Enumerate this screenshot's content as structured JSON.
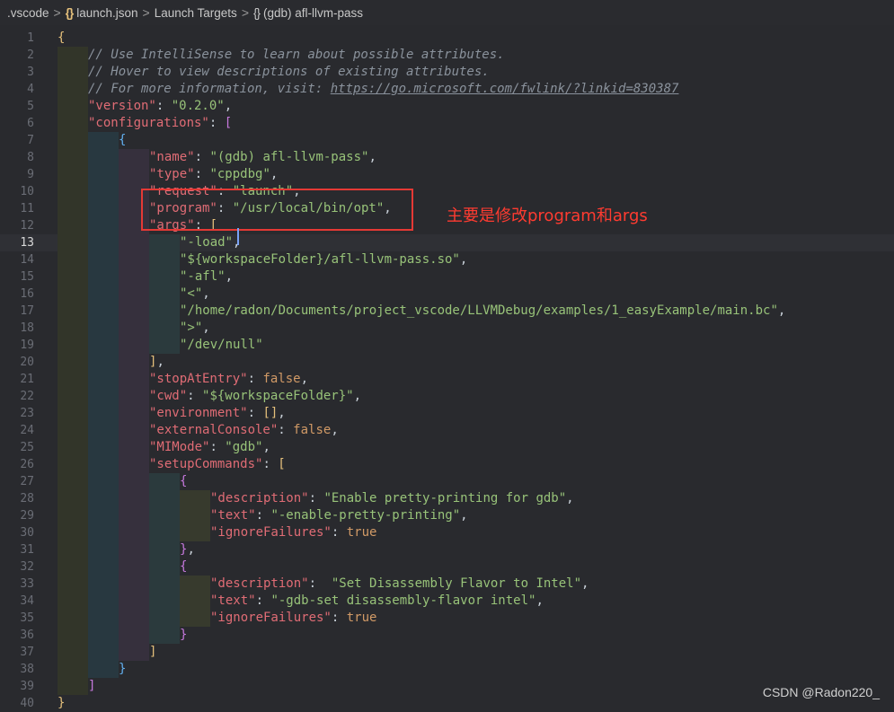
{
  "breadcrumb": {
    "items": [
      ".vscode",
      "launch.json",
      "Launch Targets",
      "(gdb) afl-llvm-pass"
    ],
    "separator": ">"
  },
  "editor": {
    "current_line": 13,
    "lines": [
      {
        "n": "1",
        "indent": [],
        "t": [
          [
            "{",
            "br1"
          ]
        ]
      },
      {
        "n": "2",
        "indent": [
          0
        ],
        "t": [
          [
            "// Use IntelliSense to learn about possible attributes.",
            "c"
          ]
        ]
      },
      {
        "n": "3",
        "indent": [
          0
        ],
        "t": [
          [
            "// Hover to view descriptions of existing attributes.",
            "c"
          ]
        ]
      },
      {
        "n": "4",
        "indent": [
          0
        ],
        "t": [
          [
            "// For more information, visit: ",
            "c"
          ],
          [
            "https://go.microsoft.com/fwlink/?linkid=830387",
            "u"
          ]
        ]
      },
      {
        "n": "5",
        "indent": [
          0
        ],
        "t": [
          [
            "\"version\"",
            "k"
          ],
          [
            ": ",
            "p"
          ],
          [
            "\"0.2.0\"",
            "s"
          ],
          [
            ",",
            "p"
          ]
        ]
      },
      {
        "n": "6",
        "indent": [
          0
        ],
        "t": [
          [
            "\"configurations\"",
            "k"
          ],
          [
            ": ",
            "p"
          ],
          [
            "[",
            "br2"
          ]
        ]
      },
      {
        "n": "7",
        "indent": [
          0,
          1
        ],
        "t": [
          [
            "{",
            "br3"
          ]
        ]
      },
      {
        "n": "8",
        "indent": [
          0,
          1,
          2
        ],
        "t": [
          [
            "\"name\"",
            "k"
          ],
          [
            ": ",
            "p"
          ],
          [
            "\"(gdb) afl-llvm-pass\"",
            "s"
          ],
          [
            ",",
            "p"
          ]
        ]
      },
      {
        "n": "9",
        "indent": [
          0,
          1,
          2
        ],
        "t": [
          [
            "\"type\"",
            "k"
          ],
          [
            ": ",
            "p"
          ],
          [
            "\"cppdbg\"",
            "s"
          ],
          [
            ",",
            "p"
          ]
        ]
      },
      {
        "n": "10",
        "indent": [
          0,
          1,
          2
        ],
        "t": [
          [
            "\"request\"",
            "k"
          ],
          [
            ": ",
            "p"
          ],
          [
            "\"launch\"",
            "s"
          ],
          [
            ",",
            "p"
          ]
        ]
      },
      {
        "n": "11",
        "indent": [
          0,
          1,
          2
        ],
        "t": [
          [
            "\"program\"",
            "k"
          ],
          [
            ": ",
            "p"
          ],
          [
            "\"/usr/local/bin/opt\"",
            "s"
          ],
          [
            ",",
            "p"
          ]
        ]
      },
      {
        "n": "12",
        "indent": [
          0,
          1,
          2
        ],
        "t": [
          [
            "\"args\"",
            "k"
          ],
          [
            ": ",
            "p"
          ],
          [
            "[",
            "br1"
          ]
        ]
      },
      {
        "n": "13",
        "indent": [
          0,
          1,
          2,
          3
        ],
        "t": [
          [
            "\"-load\"",
            "s"
          ],
          [
            ",",
            "p"
          ]
        ]
      },
      {
        "n": "14",
        "indent": [
          0,
          1,
          2,
          3
        ],
        "t": [
          [
            "\"${workspaceFolder}/afl-llvm-pass.so\"",
            "s"
          ],
          [
            ",",
            "p"
          ]
        ]
      },
      {
        "n": "15",
        "indent": [
          0,
          1,
          2,
          3
        ],
        "t": [
          [
            "\"-afl\"",
            "s"
          ],
          [
            ",",
            "p"
          ]
        ]
      },
      {
        "n": "16",
        "indent": [
          0,
          1,
          2,
          3
        ],
        "t": [
          [
            "\"<\"",
            "s"
          ],
          [
            ",",
            "p"
          ]
        ]
      },
      {
        "n": "17",
        "indent": [
          0,
          1,
          2,
          3
        ],
        "t": [
          [
            "\"/home/radon/Documents/project_vscode/LLVMDebug/examples/1_easyExample/main.bc\"",
            "s"
          ],
          [
            ",",
            "p"
          ]
        ]
      },
      {
        "n": "18",
        "indent": [
          0,
          1,
          2,
          3
        ],
        "t": [
          [
            "\">\"",
            "s"
          ],
          [
            ",",
            "p"
          ]
        ]
      },
      {
        "n": "19",
        "indent": [
          0,
          1,
          2,
          3
        ],
        "t": [
          [
            "\"/dev/null\"",
            "s"
          ]
        ]
      },
      {
        "n": "20",
        "indent": [
          0,
          1,
          2
        ],
        "t": [
          [
            "]",
            "br1"
          ],
          [
            ",",
            "p"
          ]
        ]
      },
      {
        "n": "21",
        "indent": [
          0,
          1,
          2
        ],
        "t": [
          [
            "\"stopAtEntry\"",
            "k"
          ],
          [
            ": ",
            "p"
          ],
          [
            "false",
            "kw"
          ],
          [
            ",",
            "p"
          ]
        ]
      },
      {
        "n": "22",
        "indent": [
          0,
          1,
          2
        ],
        "t": [
          [
            "\"cwd\"",
            "k"
          ],
          [
            ": ",
            "p"
          ],
          [
            "\"${workspaceFolder}\"",
            "s"
          ],
          [
            ",",
            "p"
          ]
        ]
      },
      {
        "n": "23",
        "indent": [
          0,
          1,
          2
        ],
        "t": [
          [
            "\"environment\"",
            "k"
          ],
          [
            ": ",
            "p"
          ],
          [
            "[]",
            "br1"
          ],
          [
            ",",
            "p"
          ]
        ]
      },
      {
        "n": "24",
        "indent": [
          0,
          1,
          2
        ],
        "t": [
          [
            "\"externalConsole\"",
            "k"
          ],
          [
            ": ",
            "p"
          ],
          [
            "false",
            "kw"
          ],
          [
            ",",
            "p"
          ]
        ]
      },
      {
        "n": "25",
        "indent": [
          0,
          1,
          2
        ],
        "t": [
          [
            "\"MIMode\"",
            "k"
          ],
          [
            ": ",
            "p"
          ],
          [
            "\"gdb\"",
            "s"
          ],
          [
            ",",
            "p"
          ]
        ]
      },
      {
        "n": "26",
        "indent": [
          0,
          1,
          2
        ],
        "t": [
          [
            "\"setupCommands\"",
            "k"
          ],
          [
            ": ",
            "p"
          ],
          [
            "[",
            "br1"
          ]
        ]
      },
      {
        "n": "27",
        "indent": [
          0,
          1,
          2,
          3
        ],
        "t": [
          [
            "{",
            "br2"
          ]
        ]
      },
      {
        "n": "28",
        "indent": [
          0,
          1,
          2,
          3,
          4
        ],
        "t": [
          [
            "\"description\"",
            "k"
          ],
          [
            ": ",
            "p"
          ],
          [
            "\"Enable pretty-printing for gdb\"",
            "s"
          ],
          [
            ",",
            "p"
          ]
        ]
      },
      {
        "n": "29",
        "indent": [
          0,
          1,
          2,
          3,
          4
        ],
        "t": [
          [
            "\"text\"",
            "k"
          ],
          [
            ": ",
            "p"
          ],
          [
            "\"-enable-pretty-printing\"",
            "s"
          ],
          [
            ",",
            "p"
          ]
        ]
      },
      {
        "n": "30",
        "indent": [
          0,
          1,
          2,
          3,
          4
        ],
        "t": [
          [
            "\"ignoreFailures\"",
            "k"
          ],
          [
            ": ",
            "p"
          ],
          [
            "true",
            "kw"
          ]
        ]
      },
      {
        "n": "31",
        "indent": [
          0,
          1,
          2,
          3
        ],
        "t": [
          [
            "}",
            "br2"
          ],
          [
            ",",
            "p"
          ]
        ]
      },
      {
        "n": "32",
        "indent": [
          0,
          1,
          2,
          3
        ],
        "t": [
          [
            "{",
            "br2"
          ]
        ]
      },
      {
        "n": "33",
        "indent": [
          0,
          1,
          2,
          3,
          4
        ],
        "t": [
          [
            "\"description\"",
            "k"
          ],
          [
            ":  ",
            "p"
          ],
          [
            "\"Set Disassembly Flavor to Intel\"",
            "s"
          ],
          [
            ",",
            "p"
          ]
        ]
      },
      {
        "n": "34",
        "indent": [
          0,
          1,
          2,
          3,
          4
        ],
        "t": [
          [
            "\"text\"",
            "k"
          ],
          [
            ": ",
            "p"
          ],
          [
            "\"-gdb-set disassembly-flavor intel\"",
            "s"
          ],
          [
            ",",
            "p"
          ]
        ]
      },
      {
        "n": "35",
        "indent": [
          0,
          1,
          2,
          3,
          4
        ],
        "t": [
          [
            "\"ignoreFailures\"",
            "k"
          ],
          [
            ": ",
            "p"
          ],
          [
            "true",
            "kw"
          ]
        ]
      },
      {
        "n": "36",
        "indent": [
          0,
          1,
          2,
          3
        ],
        "t": [
          [
            "}",
            "br2"
          ]
        ]
      },
      {
        "n": "37",
        "indent": [
          0,
          1,
          2
        ],
        "t": [
          [
            "]",
            "br1"
          ]
        ]
      },
      {
        "n": "38",
        "indent": [
          0,
          1
        ],
        "t": [
          [
            "}",
            "br3"
          ]
        ]
      },
      {
        "n": "39",
        "indent": [
          0
        ],
        "t": [
          [
            "]",
            "br2"
          ]
        ]
      },
      {
        "n": "40",
        "indent": [],
        "t": [
          [
            "}",
            "br1"
          ]
        ]
      }
    ]
  },
  "annotation": {
    "text": "主要是修改program和args",
    "color": "#ff3b30"
  },
  "watermark": {
    "text": "CSDN @Radon220_"
  },
  "colors": {
    "background": "#292a2e",
    "json_key": "#e06c75",
    "json_string": "#98c379",
    "comment": "#8a929c",
    "literal": "#d19a66",
    "highlight_box": "#e53935"
  }
}
